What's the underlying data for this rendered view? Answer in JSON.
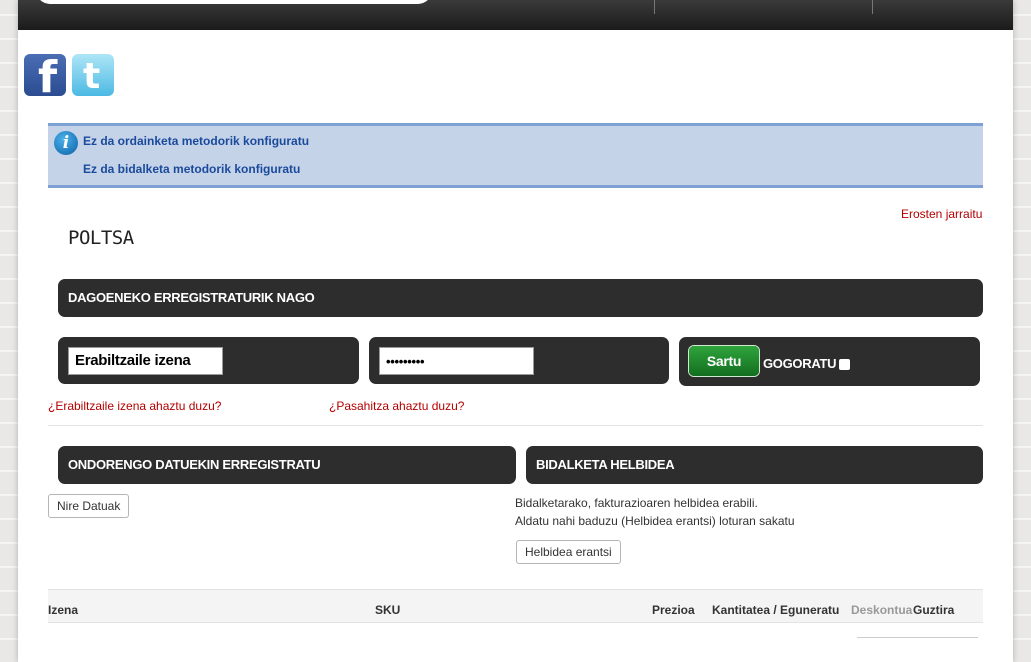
{
  "info": {
    "line1": "Ez da ordainketa metodorik konfiguratu",
    "line2": "Ez da bidalketa metodorik konfiguratu"
  },
  "links": {
    "continue_shopping": "Erosten jarraitu",
    "forgot_username": "¿Erabiltzaile izena ahaztu duzu?",
    "forgot_password": "¿Pasahitza ahaztu duzu?"
  },
  "cart_title": "POLTSA",
  "login": {
    "header": "DAGOENEKO ERREGISTRATURIK NAGO",
    "username_value": "Erabiltzaile izena",
    "password_value": "•••••••••",
    "submit": "Sartu",
    "remember": "GOGORATU"
  },
  "register": {
    "header": "ONDORENGO DATUEKIN ERREGISTRATU",
    "my_data_button": "Nire Datuak"
  },
  "shipping": {
    "header": "BIDALKETA HELBIDEA",
    "text1": "Bidalketarako, fakturazioaren helbidea erabili.",
    "text2": "Aldatu nahi baduzu (Helbidea erantsi) loturan sakatu",
    "add_button": "Helbidea erantsi"
  },
  "table": {
    "columns": [
      "Izena",
      "SKU",
      "Prezioa",
      "Kantitatea / Eguneratu",
      "Deskontua",
      "Guztira"
    ]
  },
  "social": {
    "facebook_icon": "facebook-icon",
    "twitter_icon": "twitter-icon"
  }
}
